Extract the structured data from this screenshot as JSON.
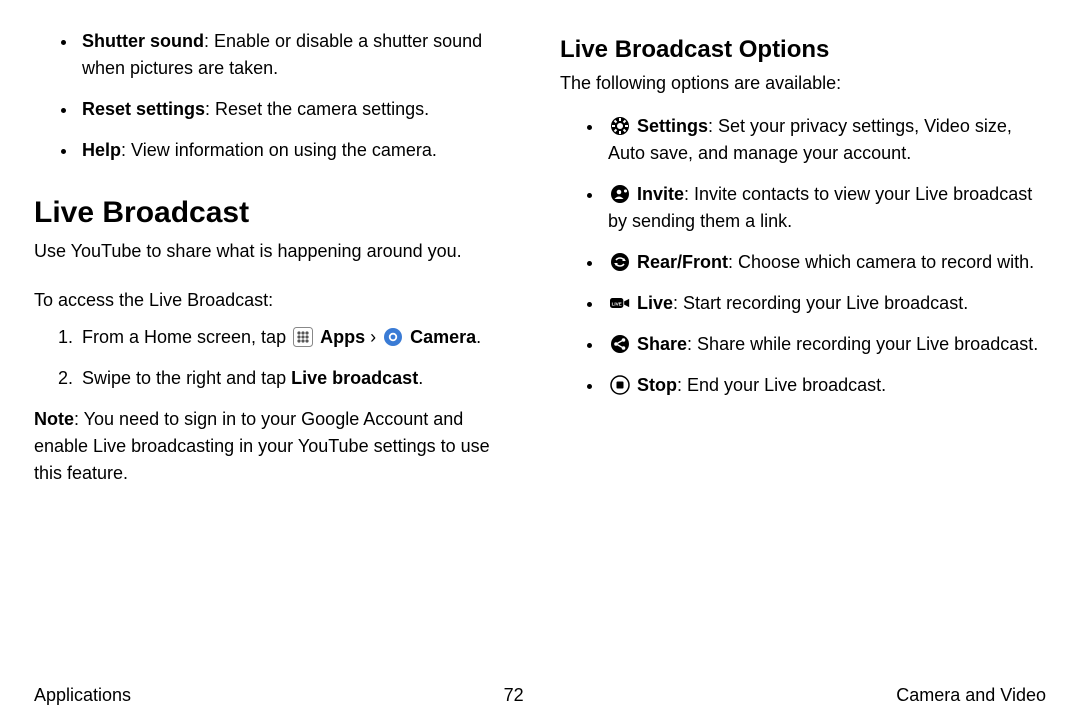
{
  "left": {
    "top_bullets": [
      {
        "term": "Shutter sound",
        "desc": ": Enable or disable a shutter sound when pictures are taken."
      },
      {
        "term": "Reset settings",
        "desc": ": Reset the camera settings."
      },
      {
        "term": "Help",
        "desc": ": View information on using the camera."
      }
    ],
    "heading": "Live Broadcast",
    "intro": "Use YouTube to share what is happening around you.",
    "access_lead": "To access the Live Broadcast:",
    "step1": {
      "pre": "From a Home screen, tap ",
      "apps_label": "Apps",
      "separator": " › ",
      "camera_label": "Camera",
      "post": "."
    },
    "step2": {
      "pre": "Swipe to the right and tap ",
      "bold": "Live broadcast",
      "post": "."
    },
    "note_label": "Note",
    "note_body": ": You need to sign in to your Google Account and enable Live broadcasting in your YouTube settings to use this feature."
  },
  "right": {
    "heading": "Live Broadcast Options",
    "intro": "The following options are available:",
    "items": [
      {
        "icon": "gear",
        "term": "Settings",
        "desc": ": Set your privacy settings, Video size, Auto save, and manage your account."
      },
      {
        "icon": "invite",
        "term": "Invite",
        "desc": ": Invite contacts to view your Live broadcast by sending them a link."
      },
      {
        "icon": "swap",
        "term": "Rear/Front",
        "desc": ": Choose which camera to record with."
      },
      {
        "icon": "live",
        "term": "Live",
        "desc": ": Start recording your Live broadcast."
      },
      {
        "icon": "share",
        "term": "Share",
        "desc": ": Share while recording your Live broadcast."
      },
      {
        "icon": "stop",
        "term": "Stop",
        "desc": ": End your Live broadcast."
      }
    ]
  },
  "footer": {
    "left": "Applications",
    "center": "72",
    "right": "Camera and Video"
  }
}
